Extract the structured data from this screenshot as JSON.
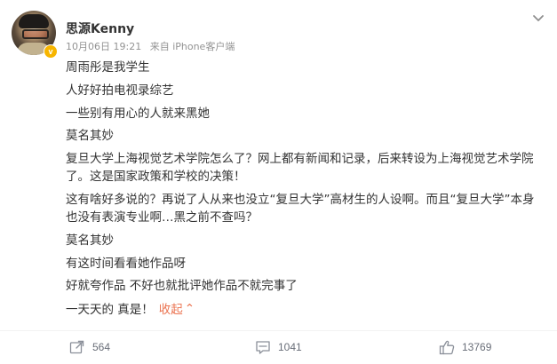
{
  "post": {
    "author": {
      "name": "思源Kenny",
      "verified_badge": "v"
    },
    "meta": {
      "time": "10月06日 19:21",
      "source": "来自 iPhone客户端"
    },
    "content": {
      "lines": [
        "周雨彤是我学生",
        "人好好拍电视录综艺",
        "一些别有用心的人就来黑她",
        "莫名其妙",
        "复旦大学上海视觉艺术学院怎么了？网上都有新闻和记录，后来转设为上海视觉艺术学院了。这是国家政策和学校的决策！",
        "这有啥好多说的？再说了人从来也没立“复旦大学”高材生的人设啊。而且“复旦大学”本身也没有表演专业啊…黑之前不查吗？",
        "莫名其妙",
        "有这时间看看她作品呀",
        "好就夸作品 不好也就批评她作品不就完事了",
        "一天天的 真是！"
      ],
      "collapse_label": "收起",
      "collapse_caret": "⌃"
    },
    "actions": {
      "repost_count": "564",
      "comment_count": "1041",
      "like_count": "13769"
    }
  },
  "colors": {
    "text": "#333333",
    "meta": "#939393",
    "link": "#eb7350",
    "action": "#696e78",
    "badge": "#f7b500"
  },
  "icons": {
    "repost": "share-icon",
    "comment": "comment-icon",
    "like": "thumbs-up-icon",
    "menu": "chevron-down-icon"
  }
}
